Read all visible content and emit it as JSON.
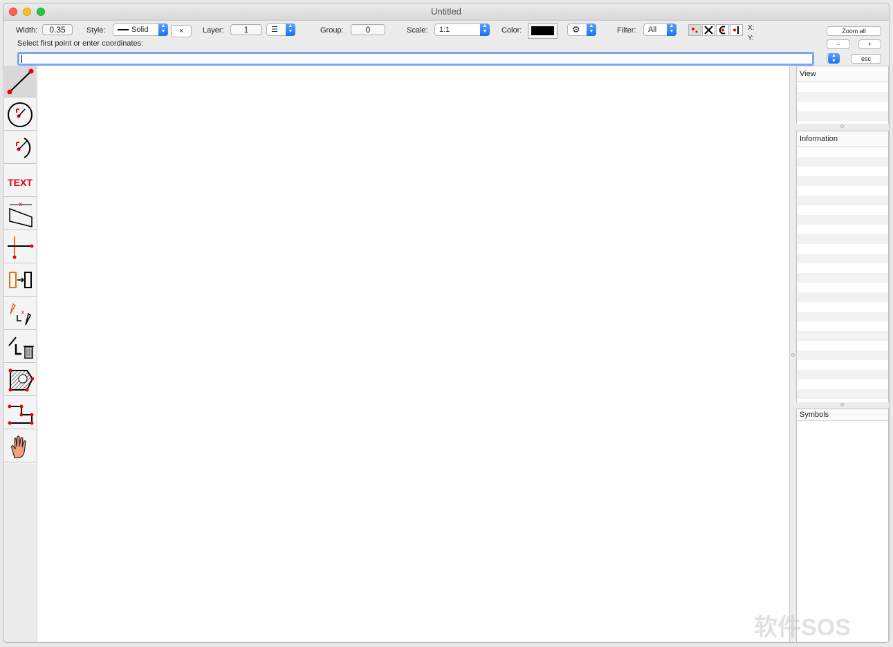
{
  "window": {
    "title": "Untitled"
  },
  "toolbar": {
    "width_label": "Width:",
    "width_value": "0.35",
    "style_label": "Style:",
    "style_value": "Solid",
    "style_clear": "×",
    "layer_label": "Layer:",
    "layer_value": "1",
    "group_label": "Group:",
    "group_value": "0",
    "scale_label": "Scale:",
    "scale_value": "1:1",
    "color_label": "Color:",
    "color_value": "#000000",
    "filter_label": "Filter:",
    "filter_value": "All",
    "x_label": "X:",
    "y_label": "Y:",
    "zoom_all": "Zoom all",
    "zoom_out": "-",
    "zoom_in": "+",
    "esc": "esc"
  },
  "prompt": {
    "text": "Select first point or enter coordinates:",
    "input_value": ""
  },
  "tools": [
    {
      "name": "line-tool",
      "icon": "line-icon"
    },
    {
      "name": "circle-tool",
      "icon": "circle-icon"
    },
    {
      "name": "arc-tool",
      "icon": "arc-icon"
    },
    {
      "name": "text-tool",
      "icon": "text-icon",
      "label": "TEXT"
    },
    {
      "name": "dimension-tool",
      "icon": "dimension-icon"
    },
    {
      "name": "trim-tool",
      "icon": "trim-icon"
    },
    {
      "name": "copy-move-tool",
      "icon": "copy-move-icon"
    },
    {
      "name": "edit-tool",
      "icon": "edit-icon"
    },
    {
      "name": "delete-tool",
      "icon": "delete-icon"
    },
    {
      "name": "hatch-tool",
      "icon": "hatch-icon"
    },
    {
      "name": "polyline-tool",
      "icon": "polyline-icon"
    },
    {
      "name": "pan-tool",
      "icon": "hand-icon"
    }
  ],
  "panels": {
    "view": "View",
    "information": "Information",
    "symbols": "Symbols"
  },
  "watermark": "软件SOS"
}
